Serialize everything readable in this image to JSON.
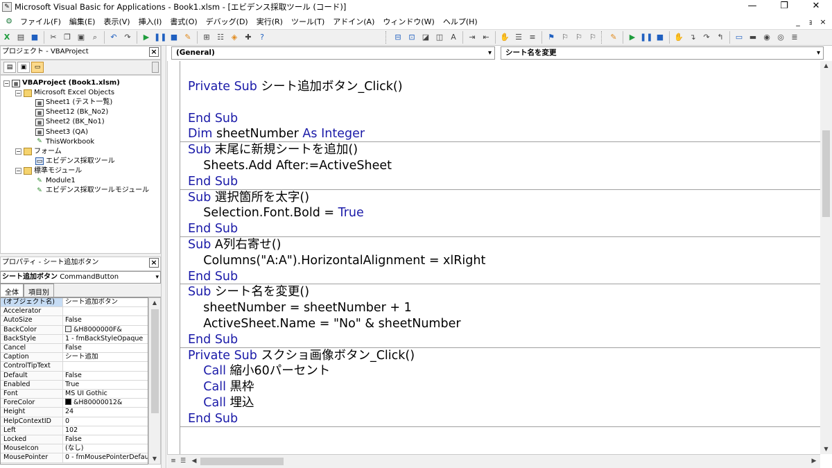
{
  "window": {
    "title": "Microsoft Visual Basic for Applications - Book1.xlsm - [エビデンス採取ツール (コード)]",
    "minimize": "—",
    "restore": "❐",
    "close": "✕"
  },
  "menu": {
    "items": [
      "ファイル(F)",
      "編集(E)",
      "表示(V)",
      "挿入(I)",
      "書式(O)",
      "デバッグ(D)",
      "実行(R)",
      "ツール(T)",
      "アドイン(A)",
      "ウィンドウ(W)",
      "ヘルプ(H)"
    ],
    "mdi_minimize": "_",
    "mdi_restore": "ｮ",
    "mdi_close": "×"
  },
  "project_panel": {
    "title": "プロジェクト - VBAProject",
    "close": "×",
    "tree": [
      {
        "label": "VBAProject (Book1.xlsm)",
        "level": 0,
        "kind": "project",
        "expander": "−",
        "bold": true
      },
      {
        "label": "Microsoft Excel Objects",
        "level": 1,
        "kind": "folder",
        "expander": "−"
      },
      {
        "label": "Sheet1 (テスト一覧)",
        "level": 2,
        "kind": "sheet"
      },
      {
        "label": "Sheet12 (Bk_No2)",
        "level": 2,
        "kind": "sheet"
      },
      {
        "label": "Sheet2 (BK_No1)",
        "level": 2,
        "kind": "sheet"
      },
      {
        "label": "Sheet3 (QA)",
        "level": 2,
        "kind": "sheet"
      },
      {
        "label": "ThisWorkbook",
        "level": 2,
        "kind": "workbook"
      },
      {
        "label": "フォーム",
        "level": 1,
        "kind": "folder",
        "expander": "−"
      },
      {
        "label": "エビデンス採取ツール",
        "level": 2,
        "kind": "form"
      },
      {
        "label": "標準モジュール",
        "level": 1,
        "kind": "folder",
        "expander": "−"
      },
      {
        "label": "Module1",
        "level": 2,
        "kind": "module"
      },
      {
        "label": "エビデンス採取ツールモジュール",
        "level": 2,
        "kind": "module"
      }
    ]
  },
  "properties_panel": {
    "title": "プロパティ - シート追加ボタン",
    "close": "×",
    "object_name": "シート追加ボタン",
    "object_type": "CommandButton",
    "tabs": [
      "全体",
      "項目別"
    ],
    "rows": [
      {
        "name": "(オブジェクト名)",
        "value": "シート追加ボタン"
      },
      {
        "name": "Accelerator",
        "value": ""
      },
      {
        "name": "AutoSize",
        "value": "False"
      },
      {
        "name": "BackColor",
        "value": "&H8000000F&",
        "swatch": "#f0f0f0"
      },
      {
        "name": "BackStyle",
        "value": "1 - fmBackStyleOpaque"
      },
      {
        "name": "Cancel",
        "value": "False"
      },
      {
        "name": "Caption",
        "value": "シート追加"
      },
      {
        "name": "ControlTipText",
        "value": ""
      },
      {
        "name": "Default",
        "value": "False"
      },
      {
        "name": "Enabled",
        "value": "True"
      },
      {
        "name": "Font",
        "value": "MS UI Gothic"
      },
      {
        "name": "ForeColor",
        "value": "&H80000012&",
        "swatch": "#000000"
      },
      {
        "name": "Height",
        "value": "24"
      },
      {
        "name": "HelpContextID",
        "value": "0"
      },
      {
        "name": "Left",
        "value": "102"
      },
      {
        "name": "Locked",
        "value": "False"
      },
      {
        "name": "MouseIcon",
        "value": "(なし)"
      },
      {
        "name": "MousePointer",
        "value": "0 - fmMousePointerDefau"
      }
    ]
  },
  "code_window": {
    "object_combo": "(General)",
    "procedure_combo": "シート名を変更",
    "keyword_color": "#1a1aa8",
    "lines": [
      {
        "parts": [
          {
            "t": "Private Sub ",
            "k": true
          },
          {
            "t": "シート追加ボタン_Click()"
          }
        ]
      },
      {
        "parts": []
      },
      {
        "parts": [
          {
            "t": "End Sub",
            "k": true
          }
        ]
      },
      {
        "parts": [
          {
            "t": "Dim ",
            "k": true
          },
          {
            "t": "sheetNumber "
          },
          {
            "t": "As Integer",
            "k": true
          }
        ]
      },
      {
        "sep": true,
        "parts": [
          {
            "t": "Sub ",
            "k": true
          },
          {
            "t": "末尾に新規シートを追加()"
          }
        ]
      },
      {
        "parts": [
          {
            "t": "    Sheets.Add After:=ActiveSheet"
          }
        ]
      },
      {
        "parts": [
          {
            "t": "End Sub",
            "k": true
          }
        ]
      },
      {
        "sep": true,
        "parts": [
          {
            "t": "Sub ",
            "k": true
          },
          {
            "t": "選択箇所を太字()"
          }
        ]
      },
      {
        "parts": [
          {
            "t": "    Selection.Font.Bold = "
          },
          {
            "t": "True",
            "k": true
          }
        ]
      },
      {
        "parts": [
          {
            "t": "End Sub",
            "k": true
          }
        ]
      },
      {
        "sep": true,
        "parts": [
          {
            "t": "Sub ",
            "k": true
          },
          {
            "t": "A列右寄せ()"
          }
        ]
      },
      {
        "parts": [
          {
            "t": "    Columns(\"A:A\").HorizontalAlignment = xlRight"
          }
        ]
      },
      {
        "parts": [
          {
            "t": "End Sub",
            "k": true
          }
        ]
      },
      {
        "sep": true,
        "parts": [
          {
            "t": "Sub ",
            "k": true
          },
          {
            "t": "シート名を変更()"
          }
        ]
      },
      {
        "parts": [
          {
            "t": "    sheetNumber = sheetNumber + 1"
          }
        ]
      },
      {
        "parts": [
          {
            "t": "    ActiveSheet.Name = \"No\" & sheetNumber"
          }
        ]
      },
      {
        "parts": [
          {
            "t": "End Sub",
            "k": true
          }
        ]
      },
      {
        "sep": true,
        "parts": [
          {
            "t": "Private Sub ",
            "k": true
          },
          {
            "t": "スクショ画像ボタン_Click()"
          }
        ]
      },
      {
        "parts": [
          {
            "t": "    "
          },
          {
            "t": "Call ",
            "k": true
          },
          {
            "t": "縮小60パーセント"
          }
        ]
      },
      {
        "parts": [
          {
            "t": "    "
          },
          {
            "t": "Call ",
            "k": true
          },
          {
            "t": "黒枠"
          }
        ]
      },
      {
        "parts": [
          {
            "t": "    "
          },
          {
            "t": "Call ",
            "k": true
          },
          {
            "t": "埋込"
          }
        ]
      },
      {
        "parts": [
          {
            "t": "End Sub",
            "k": true
          }
        ]
      },
      {
        "sep": true,
        "parts": []
      }
    ]
  }
}
